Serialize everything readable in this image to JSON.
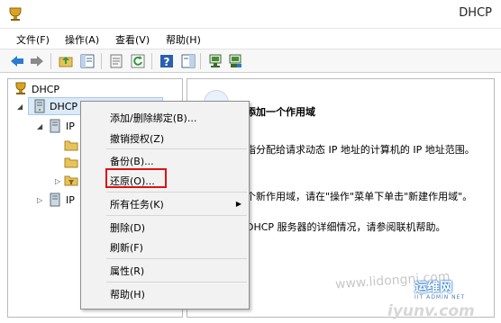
{
  "window": {
    "title": "DHCP"
  },
  "menubar": {
    "items": [
      "文件(F)",
      "操作(A)",
      "查看(V)",
      "帮助(H)"
    ]
  },
  "toolbar": {
    "buttons": [
      "back-arrow-icon",
      "forward-arrow-icon",
      "up-folder-icon",
      "console-tree-icon",
      "properties-icon",
      "refresh-icon",
      "help-icon",
      "action-pane-icon",
      "server-icon",
      "authorize-icon"
    ]
  },
  "tree": {
    "root": "DHCP",
    "server": "DHCP",
    "ipv4": "IP",
    "ipv6": "IP"
  },
  "detail": {
    "title": "添加一个作用域",
    "line1": "指分配给请求动态 IP 地址的计算机的 IP 地址范围。",
    "line2": "。",
    "line3": "个新作用域，请在\"操作\"菜单下单击\"新建作用域\"。",
    "line4": "DHCP 服务器的详细情况，请参阅联机帮助。"
  },
  "context_menu": {
    "items": [
      {
        "label": "添加/删除绑定(B)..."
      },
      {
        "label": "撤销授权(Z)"
      },
      {
        "label": "备份(B)..."
      },
      {
        "label": "还原(O)..."
      },
      {
        "label": "所有任务(K)"
      },
      {
        "label": "删除(D)"
      },
      {
        "label": "刷新(F)"
      },
      {
        "label": "属性(R)"
      },
      {
        "label": "帮助(H)"
      }
    ],
    "highlighted": "还原(O)..."
  },
  "watermark": {
    "site_url": "www.lidongni.com",
    "logo_text": "运维网",
    "logo_sub": "IIT ADMIN NET",
    "domain": "iyunv.com"
  },
  "colors": {
    "highlight_border": "#e01010",
    "selection": "#dbeaf7"
  }
}
